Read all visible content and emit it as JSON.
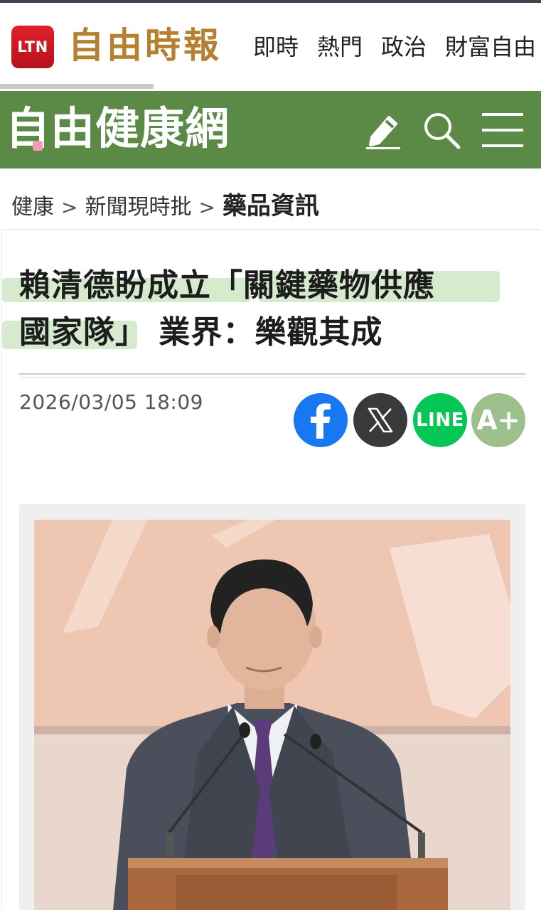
{
  "site": {
    "logo_badge": "LTN",
    "brand_name": "自由時報",
    "nav": [
      "即時",
      "熱門",
      "政治",
      "財富自由"
    ]
  },
  "health_bar": {
    "logo_text": "自由健康網",
    "icons": [
      "pencil-icon",
      "search-icon",
      "menu-icon"
    ]
  },
  "breadcrumb": {
    "items": [
      "健康",
      "新聞現時批",
      "藥品資訊"
    ],
    "separator": ">"
  },
  "article": {
    "headline_line1": "賴清德盼成立「關鍵藥物供應",
    "headline_line2": "國家隊」 業界：樂觀其成",
    "datetime": "2026/03/05 18:09"
  },
  "share": {
    "line_label": "LINE",
    "font_label": "A+",
    "colors": {
      "facebook": "#1877f2",
      "x": "#3a3a3a",
      "line": "#06c755",
      "font": "#9cbf8c"
    }
  },
  "colors": {
    "health_green": "#5a8a46",
    "brand_gold": "#b5802f",
    "ltn_red": "#d11c25"
  }
}
